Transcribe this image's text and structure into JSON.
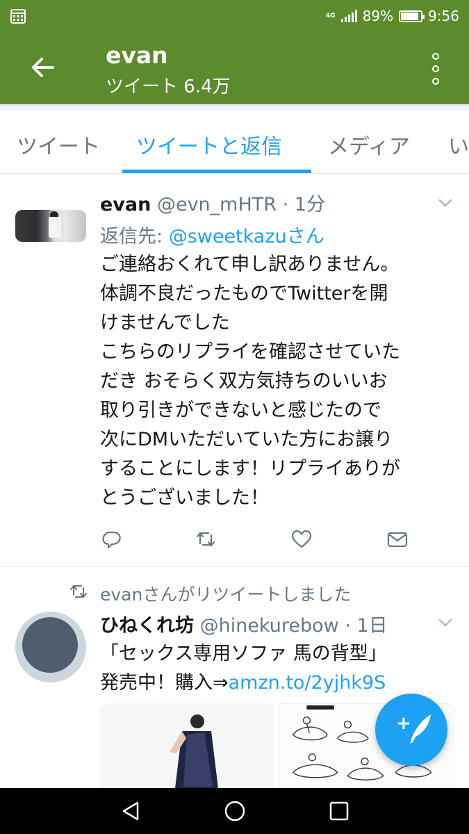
{
  "status_bar": {
    "network": "4G",
    "battery_percent": "89%",
    "battery_level": 0.89,
    "time": "9:56",
    "calendar_icon": "calendar-icon",
    "signal_icon": "signal-icon",
    "battery_icon": "battery-icon"
  },
  "app_bar": {
    "title": "evan",
    "subtitle": "ツイート 6.4万",
    "back_icon": "arrow-left-icon",
    "overflow_icon": "more-vertical-icon",
    "color": "#5b8b2c"
  },
  "tabs": [
    {
      "label": "ツイート",
      "active": false
    },
    {
      "label": "ツイートと返信",
      "active": true
    },
    {
      "label": "メディア",
      "active": false
    },
    {
      "label": "い",
      "active": false
    }
  ],
  "tweets": [
    {
      "name": "evan",
      "handle": "@evn_mHTR",
      "time": "· 1分",
      "reply_prefix": "返信先: ",
      "reply_to": "@sweetkazuさん",
      "lines": [
        "ご連絡おくれて申し訳ありません。",
        "体調不良だったものでTwitterを開",
        "けませんでした",
        "こちらのリプライを確認させていた",
        "だき おそらく双方気持ちのいいお",
        "取り引きができないと感じたので",
        "次にDMいただいていた方にお譲り",
        "することにします！リプライありが",
        "とうございました！"
      ],
      "actions": [
        "reply-icon",
        "retweet-icon",
        "like-icon",
        "direct-message-icon"
      ]
    },
    {
      "retweeted_by": "evanさんがリツイートしました",
      "name": "ひねくれ坊",
      "handle": "@hinekurebow",
      "time": "· 1日",
      "line1": "「セックス専用ソファ 馬の背型」",
      "line2_prefix": "発売中！購入⇒",
      "link": "amzn.to/2yjhk9S"
    }
  ],
  "fab": {
    "label": "+",
    "icon": "compose-tweet-icon",
    "color": "#1da1f2"
  },
  "nav_bar": {
    "back_icon": "nav-back-icon",
    "home_icon": "nav-home-icon",
    "recents_icon": "nav-recents-icon"
  },
  "colors": {
    "accent": "#1da1f2",
    "secondary_text": "#657786"
  }
}
